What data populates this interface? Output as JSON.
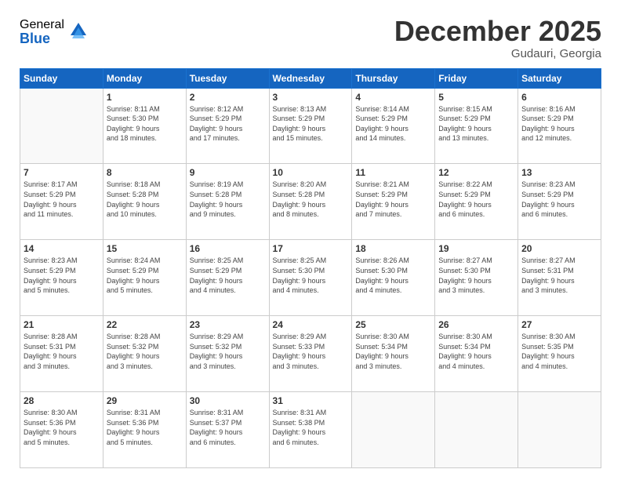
{
  "logo": {
    "general": "General",
    "blue": "Blue"
  },
  "header": {
    "month": "December 2025",
    "location": "Gudauri, Georgia"
  },
  "weekdays": [
    "Sunday",
    "Monday",
    "Tuesday",
    "Wednesday",
    "Thursday",
    "Friday",
    "Saturday"
  ],
  "weeks": [
    [
      {
        "day": "",
        "info": ""
      },
      {
        "day": "1",
        "info": "Sunrise: 8:11 AM\nSunset: 5:30 PM\nDaylight: 9 hours\nand 18 minutes."
      },
      {
        "day": "2",
        "info": "Sunrise: 8:12 AM\nSunset: 5:29 PM\nDaylight: 9 hours\nand 17 minutes."
      },
      {
        "day": "3",
        "info": "Sunrise: 8:13 AM\nSunset: 5:29 PM\nDaylight: 9 hours\nand 15 minutes."
      },
      {
        "day": "4",
        "info": "Sunrise: 8:14 AM\nSunset: 5:29 PM\nDaylight: 9 hours\nand 14 minutes."
      },
      {
        "day": "5",
        "info": "Sunrise: 8:15 AM\nSunset: 5:29 PM\nDaylight: 9 hours\nand 13 minutes."
      },
      {
        "day": "6",
        "info": "Sunrise: 8:16 AM\nSunset: 5:29 PM\nDaylight: 9 hours\nand 12 minutes."
      }
    ],
    [
      {
        "day": "7",
        "info": "Sunrise: 8:17 AM\nSunset: 5:29 PM\nDaylight: 9 hours\nand 11 minutes."
      },
      {
        "day": "8",
        "info": "Sunrise: 8:18 AM\nSunset: 5:28 PM\nDaylight: 9 hours\nand 10 minutes."
      },
      {
        "day": "9",
        "info": "Sunrise: 8:19 AM\nSunset: 5:28 PM\nDaylight: 9 hours\nand 9 minutes."
      },
      {
        "day": "10",
        "info": "Sunrise: 8:20 AM\nSunset: 5:28 PM\nDaylight: 9 hours\nand 8 minutes."
      },
      {
        "day": "11",
        "info": "Sunrise: 8:21 AM\nSunset: 5:29 PM\nDaylight: 9 hours\nand 7 minutes."
      },
      {
        "day": "12",
        "info": "Sunrise: 8:22 AM\nSunset: 5:29 PM\nDaylight: 9 hours\nand 6 minutes."
      },
      {
        "day": "13",
        "info": "Sunrise: 8:23 AM\nSunset: 5:29 PM\nDaylight: 9 hours\nand 6 minutes."
      }
    ],
    [
      {
        "day": "14",
        "info": "Sunrise: 8:23 AM\nSunset: 5:29 PM\nDaylight: 9 hours\nand 5 minutes."
      },
      {
        "day": "15",
        "info": "Sunrise: 8:24 AM\nSunset: 5:29 PM\nDaylight: 9 hours\nand 5 minutes."
      },
      {
        "day": "16",
        "info": "Sunrise: 8:25 AM\nSunset: 5:29 PM\nDaylight: 9 hours\nand 4 minutes."
      },
      {
        "day": "17",
        "info": "Sunrise: 8:25 AM\nSunset: 5:30 PM\nDaylight: 9 hours\nand 4 minutes."
      },
      {
        "day": "18",
        "info": "Sunrise: 8:26 AM\nSunset: 5:30 PM\nDaylight: 9 hours\nand 4 minutes."
      },
      {
        "day": "19",
        "info": "Sunrise: 8:27 AM\nSunset: 5:30 PM\nDaylight: 9 hours\nand 3 minutes."
      },
      {
        "day": "20",
        "info": "Sunrise: 8:27 AM\nSunset: 5:31 PM\nDaylight: 9 hours\nand 3 minutes."
      }
    ],
    [
      {
        "day": "21",
        "info": "Sunrise: 8:28 AM\nSunset: 5:31 PM\nDaylight: 9 hours\nand 3 minutes."
      },
      {
        "day": "22",
        "info": "Sunrise: 8:28 AM\nSunset: 5:32 PM\nDaylight: 9 hours\nand 3 minutes."
      },
      {
        "day": "23",
        "info": "Sunrise: 8:29 AM\nSunset: 5:32 PM\nDaylight: 9 hours\nand 3 minutes."
      },
      {
        "day": "24",
        "info": "Sunrise: 8:29 AM\nSunset: 5:33 PM\nDaylight: 9 hours\nand 3 minutes."
      },
      {
        "day": "25",
        "info": "Sunrise: 8:30 AM\nSunset: 5:34 PM\nDaylight: 9 hours\nand 3 minutes."
      },
      {
        "day": "26",
        "info": "Sunrise: 8:30 AM\nSunset: 5:34 PM\nDaylight: 9 hours\nand 4 minutes."
      },
      {
        "day": "27",
        "info": "Sunrise: 8:30 AM\nSunset: 5:35 PM\nDaylight: 9 hours\nand 4 minutes."
      }
    ],
    [
      {
        "day": "28",
        "info": "Sunrise: 8:30 AM\nSunset: 5:36 PM\nDaylight: 9 hours\nand 5 minutes."
      },
      {
        "day": "29",
        "info": "Sunrise: 8:31 AM\nSunset: 5:36 PM\nDaylight: 9 hours\nand 5 minutes."
      },
      {
        "day": "30",
        "info": "Sunrise: 8:31 AM\nSunset: 5:37 PM\nDaylight: 9 hours\nand 6 minutes."
      },
      {
        "day": "31",
        "info": "Sunrise: 8:31 AM\nSunset: 5:38 PM\nDaylight: 9 hours\nand 6 minutes."
      },
      {
        "day": "",
        "info": ""
      },
      {
        "day": "",
        "info": ""
      },
      {
        "day": "",
        "info": ""
      }
    ]
  ]
}
